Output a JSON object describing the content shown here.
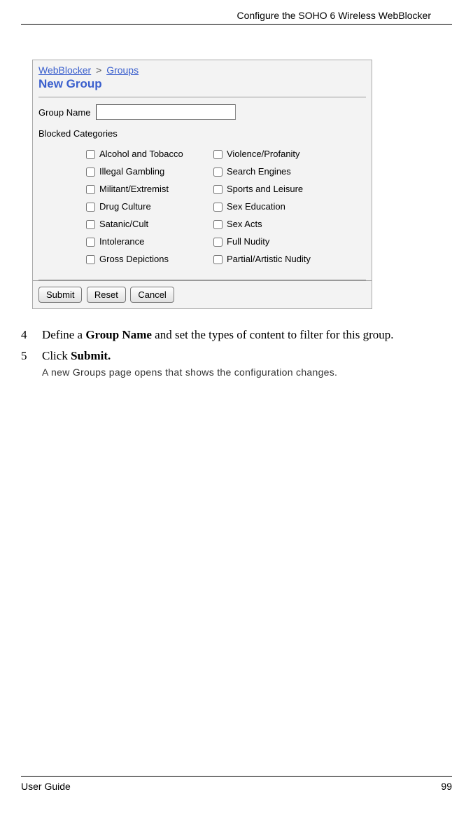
{
  "header": {
    "title": "Configure the SOHO 6 Wireless WebBlocker"
  },
  "screenshot": {
    "breadcrumb": {
      "parent": "WebBlocker",
      "separator": ">",
      "current": "Groups"
    },
    "title": "New Group",
    "form": {
      "group_name_label": "Group Name",
      "group_name_value": "",
      "blocked_label": "Blocked Categories",
      "categories": {
        "col1": [
          "Alcohol and Tobacco",
          "Illegal Gambling",
          "Militant/Extremist",
          "Drug Culture",
          "Satanic/Cult",
          "Intolerance",
          "Gross Depictions"
        ],
        "col2": [
          "Violence/Profanity",
          "Search Engines",
          "Sports and Leisure",
          "Sex Education",
          "Sex Acts",
          "Full Nudity",
          "Partial/Artistic Nudity"
        ]
      }
    },
    "buttons": {
      "submit": "Submit",
      "reset": "Reset",
      "cancel": "Cancel"
    }
  },
  "steps": {
    "s4": {
      "num": "4",
      "text_pre": "Define a ",
      "bold": "Group Name",
      "text_post": " and set the types of content to filter for this group."
    },
    "s5": {
      "num": "5",
      "text_pre": "Click ",
      "bold": "Submit.",
      "note": "A new Groups page opens that shows the configuration changes."
    }
  },
  "footer": {
    "left": "User Guide",
    "right": "99"
  }
}
